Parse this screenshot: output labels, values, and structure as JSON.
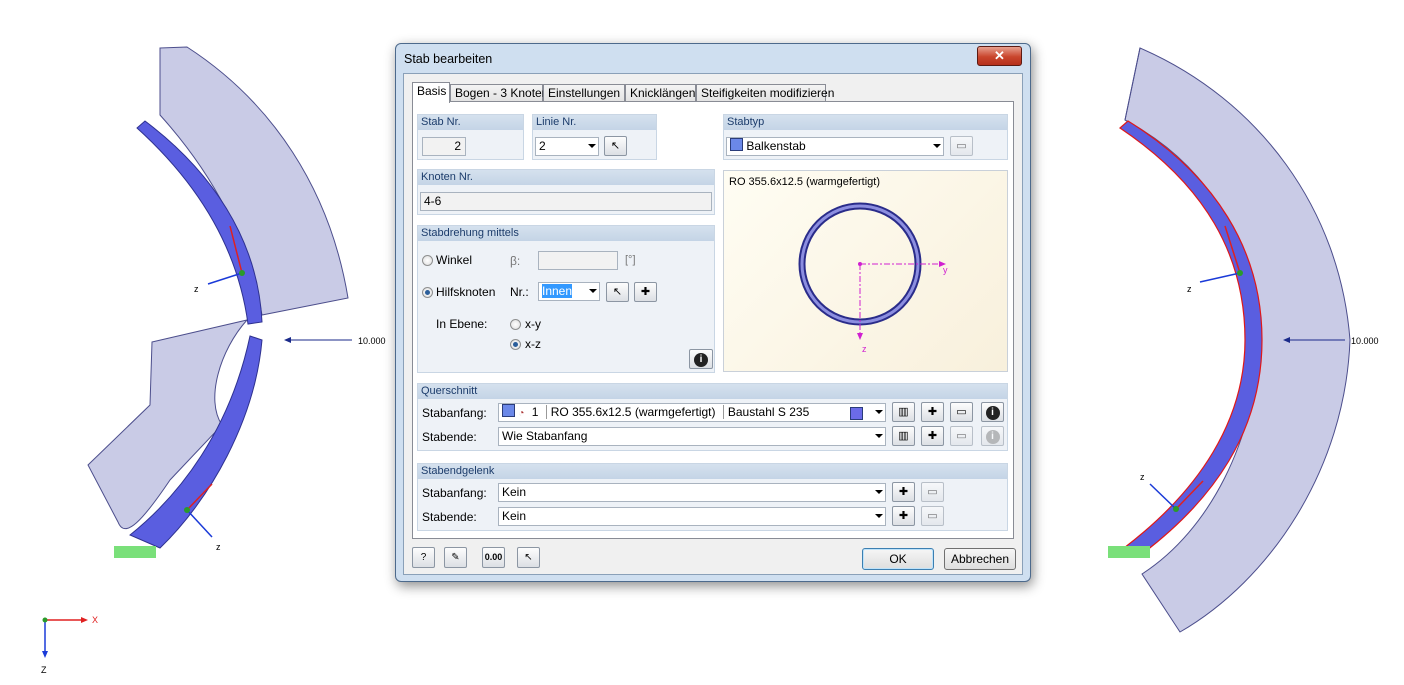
{
  "window": {
    "title": "Stab bearbeiten",
    "close_label": "✕"
  },
  "tabs": [
    "Basis",
    "Bogen - 3 Knoten",
    "Einstellungen",
    "Knicklängen",
    "Steifigkeiten modifizieren"
  ],
  "stab_nr": {
    "label": "Stab Nr.",
    "value": "2"
  },
  "linie_nr": {
    "label": "Linie Nr.",
    "value": "2"
  },
  "stabtyp": {
    "label": "Stabtyp",
    "value": "Balkenstab"
  },
  "knoten_nr": {
    "label": "Knoten Nr.",
    "value": "4-6"
  },
  "stabdrehung": {
    "label": "Stabdrehung mittels",
    "winkel": "Winkel",
    "beta": "β:",
    "unit": "[°]",
    "hilfsknoten": "Hilfsknoten",
    "nr": "Nr.:",
    "nr_value": "Innen",
    "in_ebene": "In Ebene:",
    "xy": "x-y",
    "xz": "x-z"
  },
  "section_preview": {
    "name": "RO 355.6x12.5 (warmgefertigt)",
    "y": "y",
    "z": "z"
  },
  "querschnitt": {
    "label": "Querschnitt",
    "start_label": "Stabanfang:",
    "start_no": "1",
    "start_section": "RO 355.6x12.5 (warmgefertigt)",
    "start_material": "Baustahl S 235",
    "end_label": "Stabende:",
    "end_value": "Wie Stabanfang"
  },
  "gelenk": {
    "label": "Stabendgelenk",
    "start_label": "Stabanfang:",
    "start_value": "Kein",
    "end_label": "Stabende:",
    "end_value": "Kein"
  },
  "footer": {
    "ok": "OK",
    "cancel": "Abbrechen",
    "zero_label": "0.00"
  },
  "model": {
    "load_value": "10.000",
    "axis_x": "X",
    "axis_z": "Z",
    "local_z": "z"
  }
}
